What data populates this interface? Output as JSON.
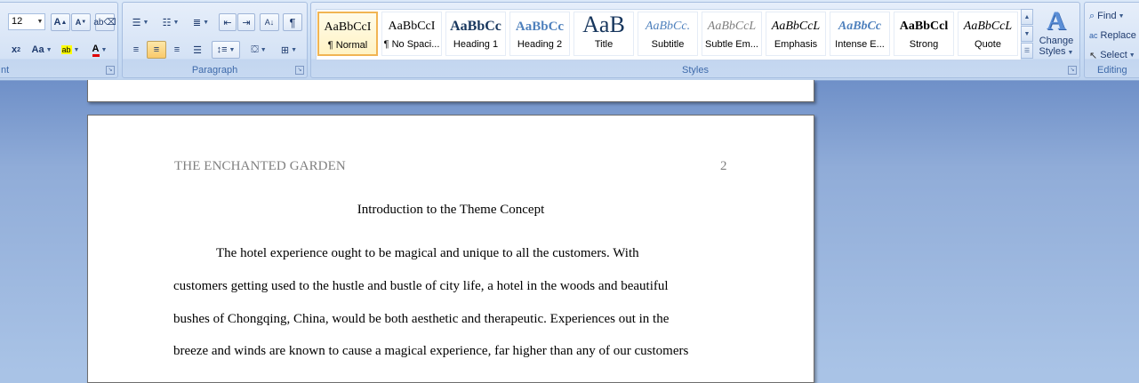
{
  "ribbon": {
    "font": {
      "label": "nt",
      "size": "12"
    },
    "paragraph": {
      "label": "Paragraph"
    },
    "styles": {
      "label": "Styles",
      "items": [
        {
          "sample": "AaBbCcI",
          "name": "¶ Normal"
        },
        {
          "sample": "AaBbCcI",
          "name": "¶ No Spaci..."
        },
        {
          "sample": "AaBbCc",
          "name": "Heading 1"
        },
        {
          "sample": "AaBbCc",
          "name": "Heading 2"
        },
        {
          "sample": "AaB",
          "name": "Title"
        },
        {
          "sample": "AaBbCc.",
          "name": "Subtitle"
        },
        {
          "sample": "AaBbCcL",
          "name": "Subtle Em..."
        },
        {
          "sample": "AaBbCcL",
          "name": "Emphasis"
        },
        {
          "sample": "AaBbCc",
          "name": "Intense E..."
        },
        {
          "sample": "AaBbCcl",
          "name": "Strong"
        },
        {
          "sample": "AaBbCcL",
          "name": "Quote"
        }
      ],
      "change_styles_line1": "Change",
      "change_styles_line2": "Styles"
    },
    "editing": {
      "label": "Editing",
      "find": "Find",
      "replace": "Replace",
      "select": "Select"
    }
  },
  "document": {
    "running_head": "THE ENCHANTED GARDEN",
    "page_number": "2",
    "title": "Introduction to the Theme Concept",
    "lines": [
      "The hotel experience ought to be magical  and unique to all the customers.  With",
      "customers getting used to the hustle and bustle of city life, a hotel in the woods and beautiful",
      "bushes of Chongqing, China, would be both aesthetic and therapeutic. Experiences out in the",
      "breeze and winds are known to cause a magical  experience,  far higher than any of our customers"
    ]
  }
}
